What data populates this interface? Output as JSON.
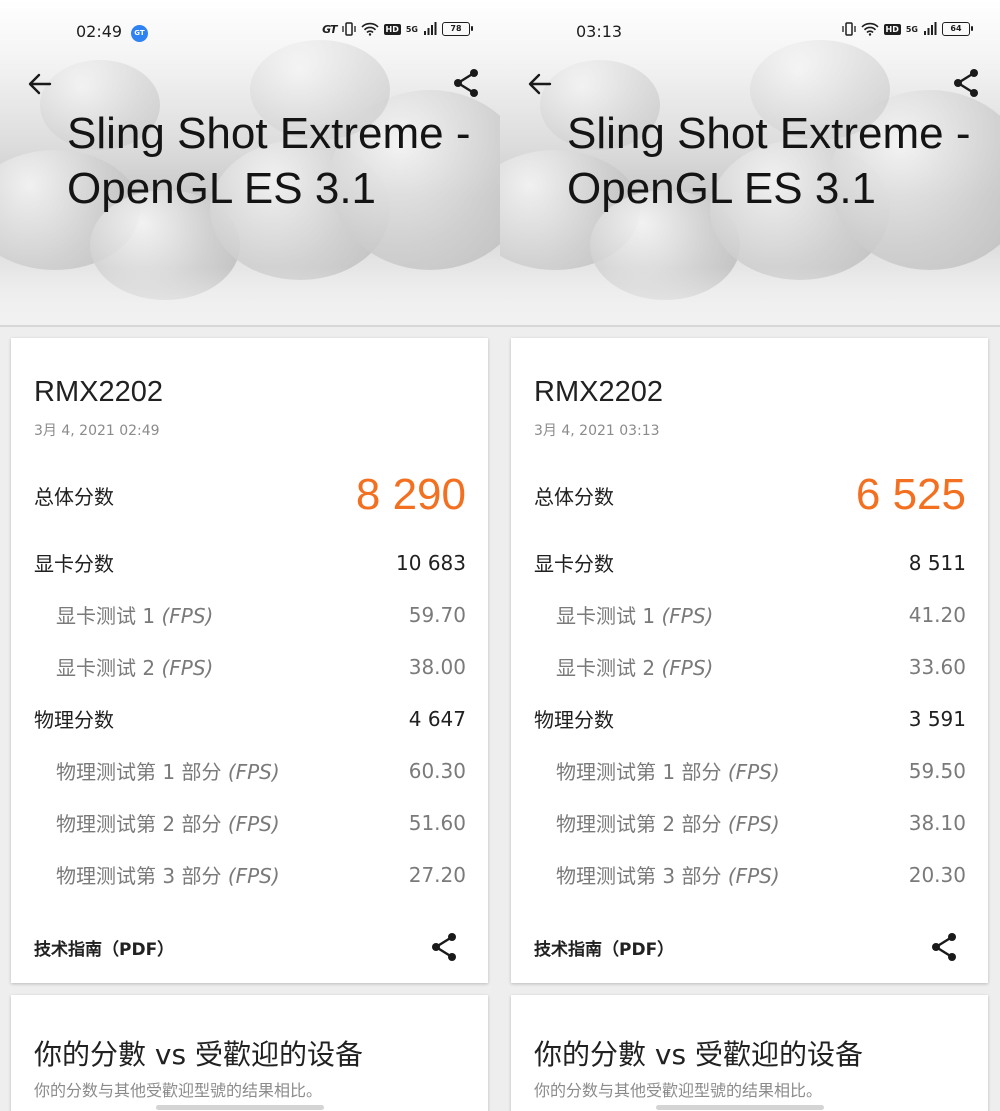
{
  "screens": [
    {
      "status": {
        "time": "02:49",
        "badge": "GT",
        "net_label": "GT",
        "hd": "HD",
        "signal": "5G",
        "battery": "78"
      },
      "header": {
        "title": "Sling Shot Extreme - OpenGL ES 3.1"
      },
      "result": {
        "device": "RMX2202",
        "date": "3月 4, 2021 02:49",
        "total_label": "总体分数",
        "total_value": "8 290",
        "graphics_label": "显卡分数",
        "graphics_value": "10 683",
        "gt1_label": "显卡测试 1",
        "gt1_value": "59.70",
        "gt2_label": "显卡测试 2",
        "gt2_value": "38.00",
        "physics_label": "物理分数",
        "physics_value": "4 647",
        "pt1_label": "物理测试第 1 部分",
        "pt1_value": "60.30",
        "pt2_label": "物理测试第 2 部分",
        "pt2_value": "51.60",
        "pt3_label": "物理测试第 3 部分",
        "pt3_value": "27.20",
        "fps_unit": "(FPS)",
        "pdf_label": "技术指南（PDF）"
      },
      "compare": {
        "title": "你的分數 vs 受歡迎的设备",
        "subtitle": "你的分数与其他受歡迎型號的结果相比。"
      }
    },
    {
      "status": {
        "time": "03:13",
        "badge": "",
        "net_label": "",
        "hd": "HD",
        "signal": "5G",
        "battery": "64"
      },
      "header": {
        "title": "Sling Shot Extreme - OpenGL ES 3.1"
      },
      "result": {
        "device": "RMX2202",
        "date": "3月 4, 2021 03:13",
        "total_label": "总体分数",
        "total_value": "6 525",
        "graphics_label": "显卡分数",
        "graphics_value": "8 511",
        "gt1_label": "显卡测试 1",
        "gt1_value": "41.20",
        "gt2_label": "显卡测试 2",
        "gt2_value": "33.60",
        "physics_label": "物理分数",
        "physics_value": "3 591",
        "pt1_label": "物理测试第 1 部分",
        "pt1_value": "59.50",
        "pt2_label": "物理测试第 2 部分",
        "pt2_value": "38.10",
        "pt3_label": "物理测试第 3 部分",
        "pt3_value": "20.30",
        "fps_unit": "(FPS)",
        "pdf_label": "技术指南（PDF）"
      },
      "compare": {
        "title": "你的分數 vs 受歡迎的设备",
        "subtitle": "你的分数与其他受歡迎型號的结果相比。"
      }
    }
  ],
  "colors": {
    "score_accent": "#f37021",
    "badge_blue": "#2f82f2",
    "text_primary": "#212121",
    "text_secondary": "#7a7a7a"
  },
  "icons": [
    "back-arrow-icon",
    "share-icon",
    "vibrate-icon",
    "wifi-icon",
    "signal-icon",
    "battery-icon"
  ]
}
